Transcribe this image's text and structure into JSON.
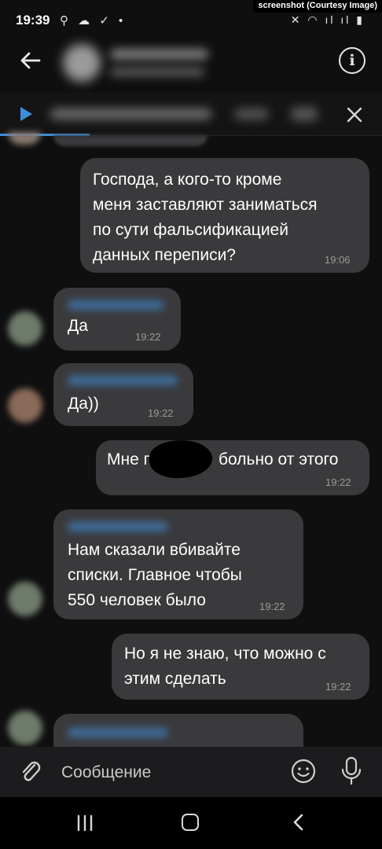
{
  "status_bar": {
    "time": "19:39",
    "left_icons": "⚲ ☁ ✓ •",
    "right_icons": "✕ ◠ ıl ıl ▮"
  },
  "watermark": "screenshot (Courtesy Image)",
  "header": {
    "back_icon": "arrow-left",
    "info_icon": "i"
  },
  "messages": [
    {
      "direction": "out",
      "text": "Господа, а кого-то кроме меня заставляют заниматься по сути фальсификацией данных переписи?",
      "lines": [
        "Господа, а кого-то кроме",
        "меня заставляют заниматься",
        "по сути фальсификацией",
        "данных переписи?"
      ],
      "time": "19:06"
    },
    {
      "direction": "in",
      "text": "Да",
      "time": "19:22"
    },
    {
      "direction": "in",
      "text": "Да))",
      "time": "19:22"
    },
    {
      "direction": "out",
      "text_before": "Мне п",
      "text_after": "больно от этого",
      "time": "19:22"
    },
    {
      "direction": "in",
      "lines": [
        "Нам сказали вбивайте",
        "списки. Главное чтобы",
        "550 человек было"
      ],
      "time": "19:22"
    },
    {
      "direction": "out",
      "lines": [
        "Но я не знаю, что можно с",
        "этим сделать"
      ],
      "time": "19:22"
    }
  ],
  "composer": {
    "placeholder": "Сообщение",
    "attach_icon": "paperclip-icon",
    "emoji_icon": "smile-icon",
    "mic_icon": "microphone-icon"
  },
  "nav": {
    "recents_label": "|||"
  },
  "colors": {
    "background": "#0f0f10",
    "bubble": "#3a3a3c",
    "accent": "#3d8ed8",
    "time": "#9a9a9a"
  }
}
